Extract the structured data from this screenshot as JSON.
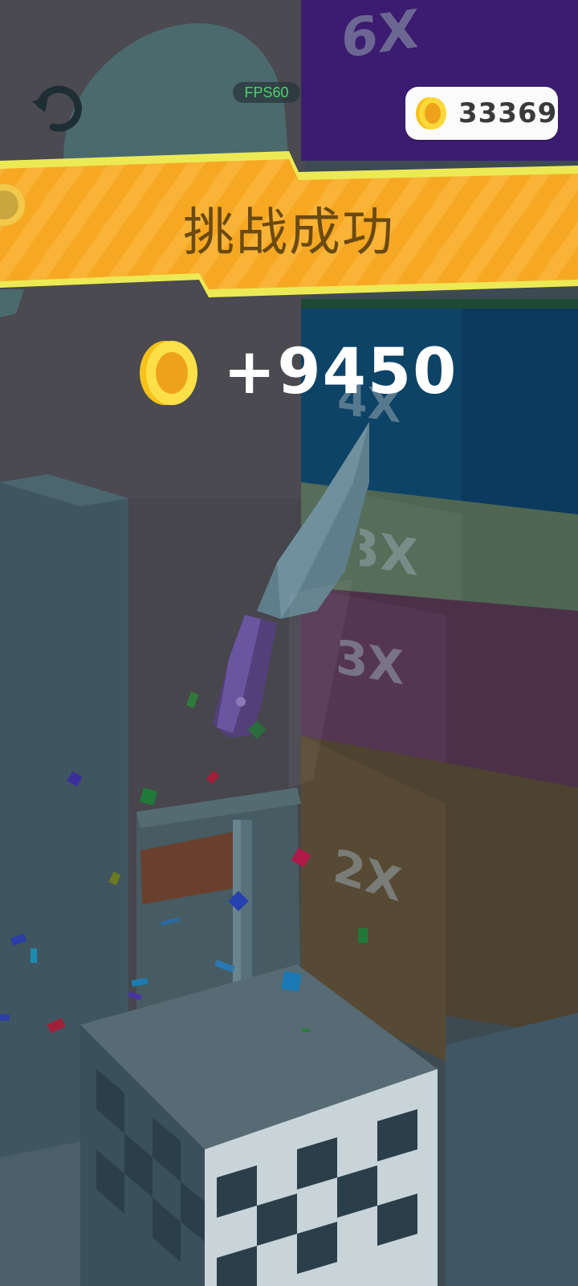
{
  "hud": {
    "fps_label": "FPS60",
    "coin_total": "33369"
  },
  "result": {
    "title": "挑战成功",
    "reward": "+9450"
  },
  "tower": {
    "multipliers": [
      "6X",
      "4X",
      "3X",
      "3X",
      "2X"
    ]
  },
  "colors": {
    "banner": "#f7a823",
    "coin": "#f5c21c",
    "tier_6x": "#3a1f6e",
    "tier_4x": "#0e3c5c",
    "tier_green": "#4f6651",
    "tier_3x": "#4e3148",
    "tier_2x": "#524430"
  },
  "icons": [
    "restart-icon",
    "coin-icon",
    "knife"
  ]
}
